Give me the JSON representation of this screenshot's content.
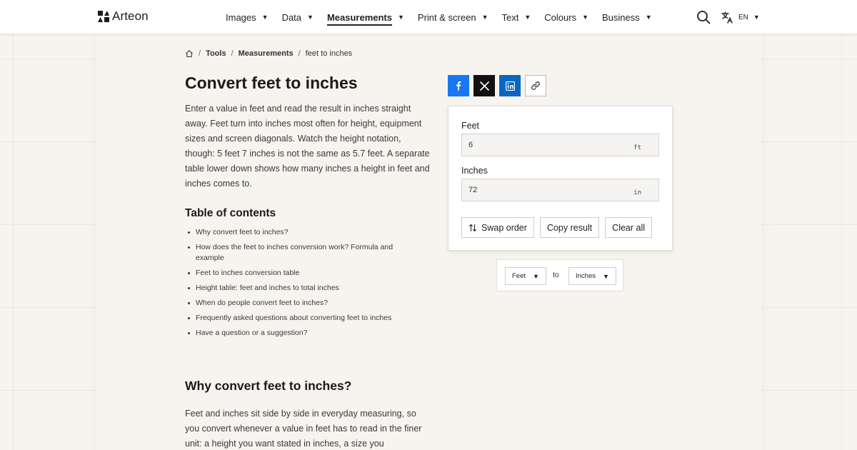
{
  "header": {
    "brand": "Arteon",
    "nav": [
      {
        "label": "Images"
      },
      {
        "label": "Data"
      },
      {
        "label": "Measurements",
        "active": true
      },
      {
        "label": "Print & screen"
      },
      {
        "label": "Text"
      },
      {
        "label": "Colours"
      },
      {
        "label": "Business"
      }
    ],
    "language": "EN",
    "icons": {
      "search": "search-icon",
      "language": "translate-icon",
      "home": "home-icon"
    }
  },
  "breadcrumb": {
    "items": [
      "Tools",
      "Measurements"
    ],
    "current": "feet to inches"
  },
  "article": {
    "title": "Convert feet to inches",
    "intro": "Enter a value in feet and read the result in inches straight away. Feet turn into inches most often for height, equipment sizes and screen diagonals. Watch the height notation, though: 5 feet 7 inches is not the same as 5.7 feet. A separate table lower down shows how many inches a height in feet and inches comes to.",
    "toc_title": "Table of contents",
    "toc": [
      "Why convert feet to inches?",
      "How does the feet to inches conversion work? Formula and example",
      "Feet to inches conversion table",
      "Height table: feet and inches to total inches",
      "When do people convert feet to inches?",
      "Frequently asked questions about converting feet to inches",
      "Have a question or a suggestion?"
    ],
    "section_title": "Why convert feet to inches?",
    "section_body": "Feet and inches sit side by side in everyday measuring, so you convert whenever a value in feet has to read in the finer unit: a height you want stated in inches, a size you"
  },
  "share": {
    "icons": [
      "facebook-icon",
      "x-icon",
      "linkedin-icon",
      "link-icon"
    ],
    "colors": {
      "facebook": "#1877f2",
      "x": "#111111",
      "linkedin": "#0a66c2"
    }
  },
  "converter": {
    "from": {
      "label": "Feet",
      "value": "6",
      "unit": "ft"
    },
    "to": {
      "label": "Inches",
      "value": "72",
      "unit": "in"
    },
    "buttons": {
      "swap": "Swap order",
      "copy": "Copy result",
      "clear": "Clear all"
    }
  },
  "unit_picker": {
    "from": "Feet",
    "connector": "to",
    "to": "Inches"
  }
}
